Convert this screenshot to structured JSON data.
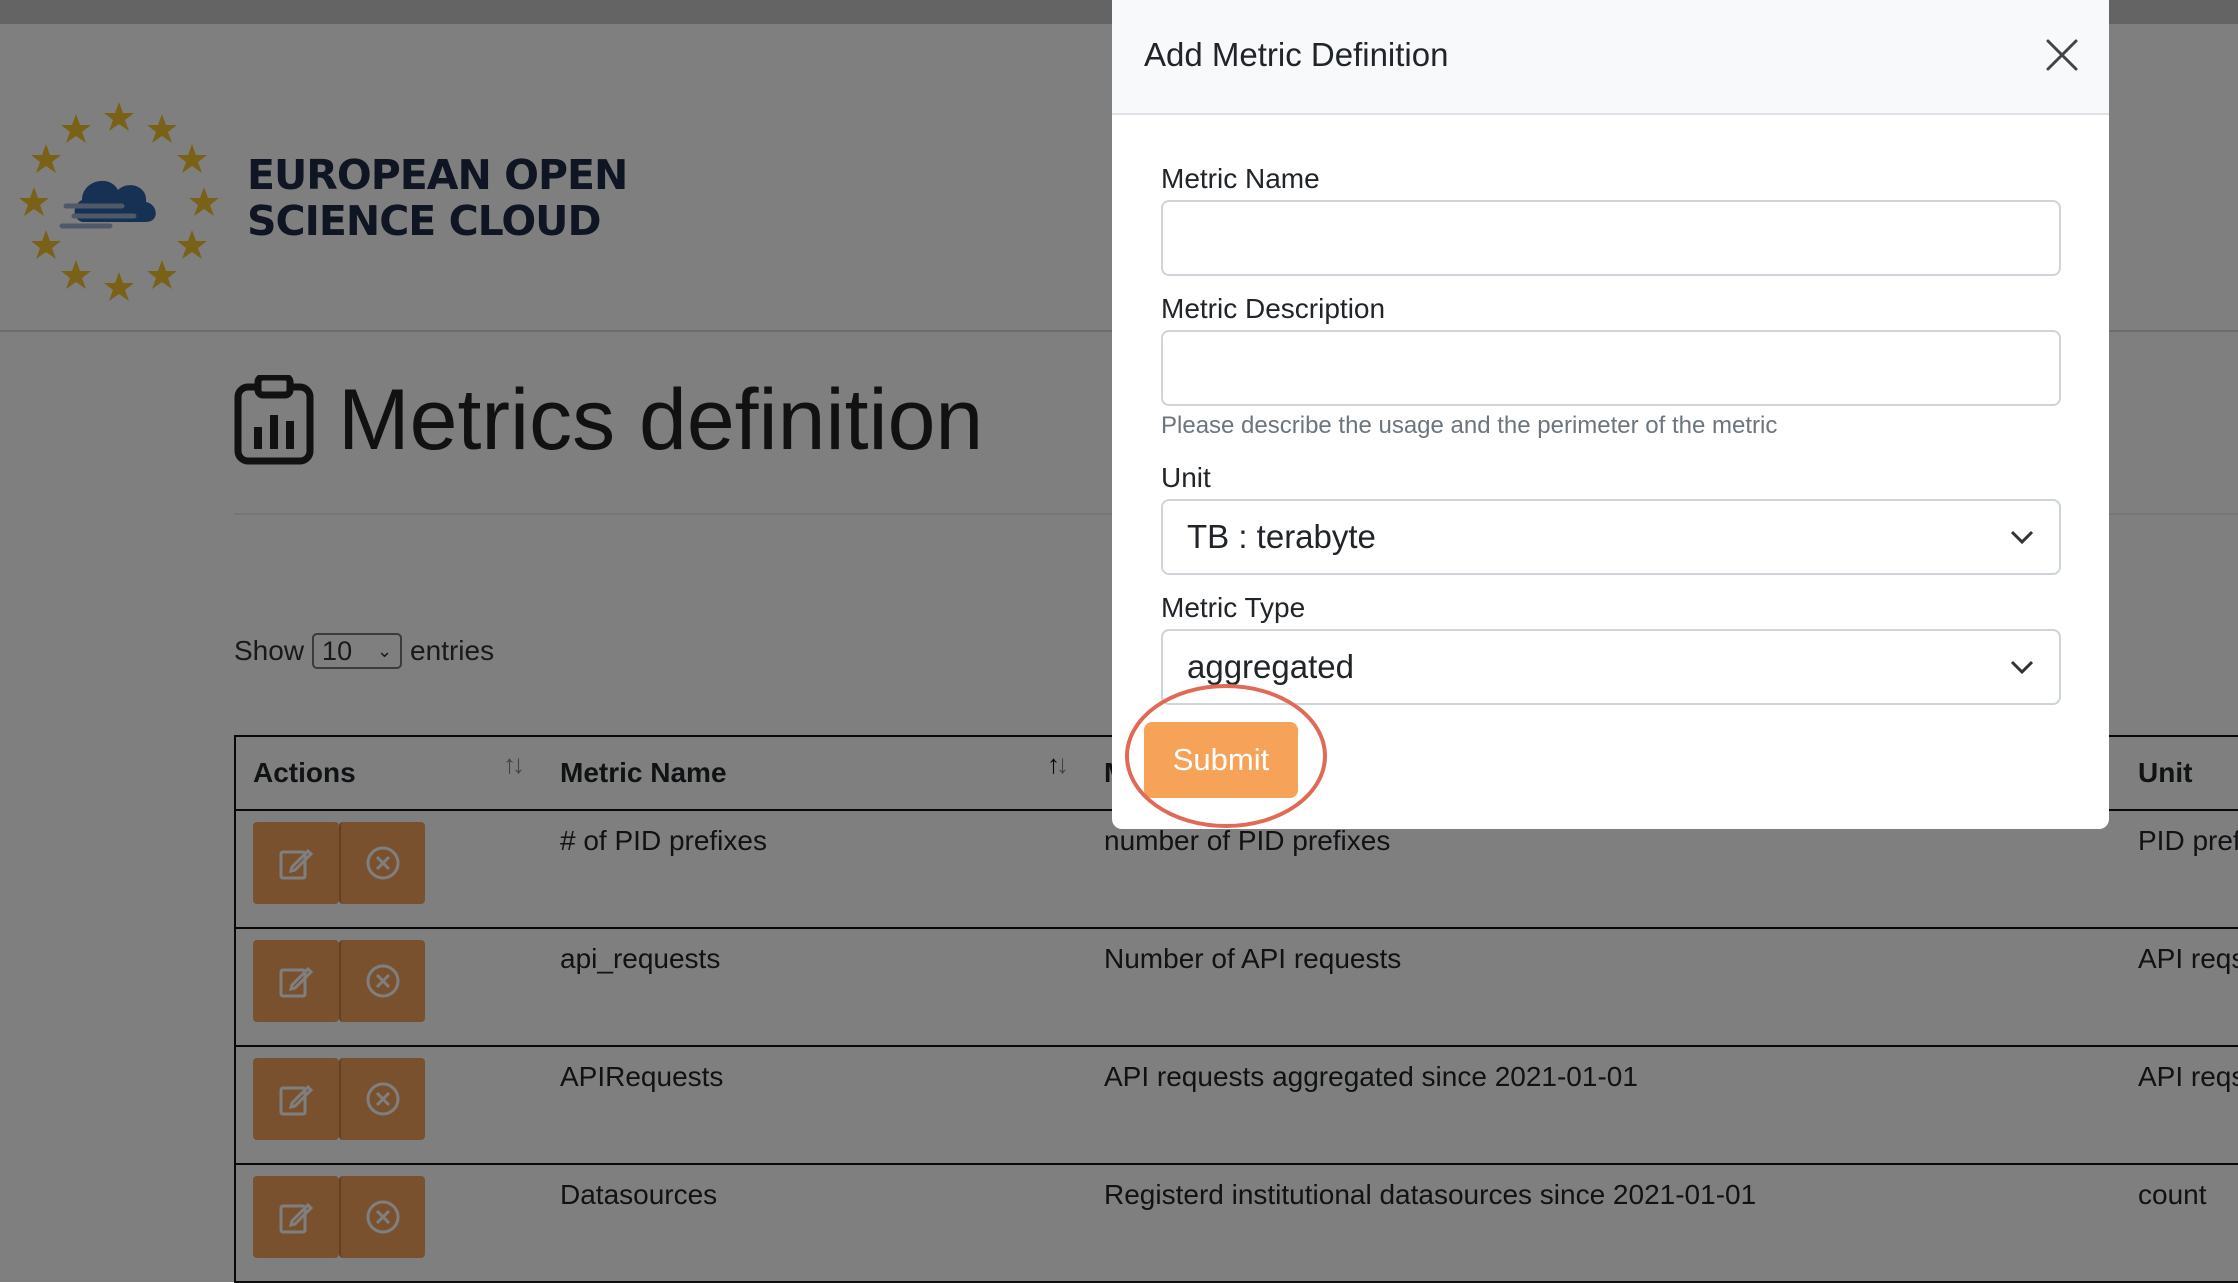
{
  "header": {
    "logo_line1": "EUROPEAN OPEN",
    "logo_line2": "SCIENCE CLOUD"
  },
  "page": {
    "title": "Metrics definition"
  },
  "entries": {
    "show_label": "Show",
    "page_size": "10",
    "entries_label": "entries"
  },
  "table": {
    "headers": [
      "Actions",
      "Metric Name",
      "M",
      "Unit"
    ],
    "rows": [
      {
        "name": "# of PID prefixes",
        "description": "number of PID prefixes",
        "unit": "PID prefix"
      },
      {
        "name": "api_requests",
        "description": "Number of API requests",
        "unit": "API reqs"
      },
      {
        "name": "APIRequests",
        "description": "API requests aggregated since 2021-01-01",
        "unit": "API reqs"
      },
      {
        "name": "Datasources",
        "description": "Registerd institutional datasources since 2021-01-01",
        "unit": "count"
      }
    ]
  },
  "modal": {
    "title": "Add Metric Definition",
    "metric_name_label": "Metric Name",
    "metric_name_value": "",
    "metric_description_label": "Metric Description",
    "metric_description_value": "",
    "metric_description_help": "Please describe the usage and the perimeter of the metric",
    "unit_label": "Unit",
    "unit_value": "TB : terabyte",
    "metric_type_label": "Metric Type",
    "metric_type_value": "aggregated",
    "submit_label": "Submit"
  },
  "colors": {
    "accent": "#f5a25d",
    "annotation": "#e06a55",
    "logo_text": "#1f2a44",
    "stars": "#f2c230"
  },
  "icons": [
    "close-icon",
    "edit-icon",
    "remove-icon",
    "chevron-down-icon",
    "sort-icon",
    "clipboard-chart-icon",
    "eosc-logo"
  ]
}
